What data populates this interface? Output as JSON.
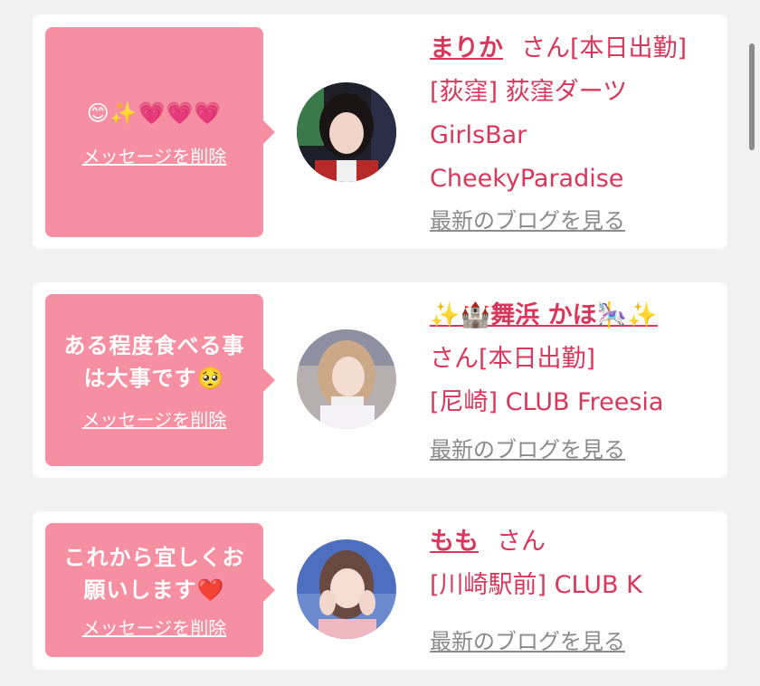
{
  "cards": [
    {
      "message": "😊✨💗💗💗",
      "delete_label": "メッセージを削除",
      "name": "まりか",
      "san": "さん[本日出勤]",
      "lines": [
        "[荻窪] 荻窪ダーツ",
        "GirlsBar",
        "CheekyParadise"
      ],
      "blog_label": "最新のブログを見る"
    },
    {
      "message": "ある程度食べる事\nは大事です🥺",
      "delete_label": "メッセージを削除",
      "name": "✨🏰舞浜 かほ🎠✨",
      "san": "さん[本日出勤]",
      "lines": [
        "[尼崎] CLUB Freesia"
      ],
      "blog_label": "最新のブログを見る"
    },
    {
      "message": "これから宜しくお\n願いします❤️",
      "delete_label": "メッセージを削除",
      "name": "もも",
      "san": "さん",
      "lines": [
        "[川崎駅前] CLUB K"
      ],
      "blog_label": "最新のブログを見る"
    }
  ],
  "colors": {
    "accent": "#d9365b",
    "bubble": "#f58fa1",
    "link_gray": "#8a8a8a"
  }
}
